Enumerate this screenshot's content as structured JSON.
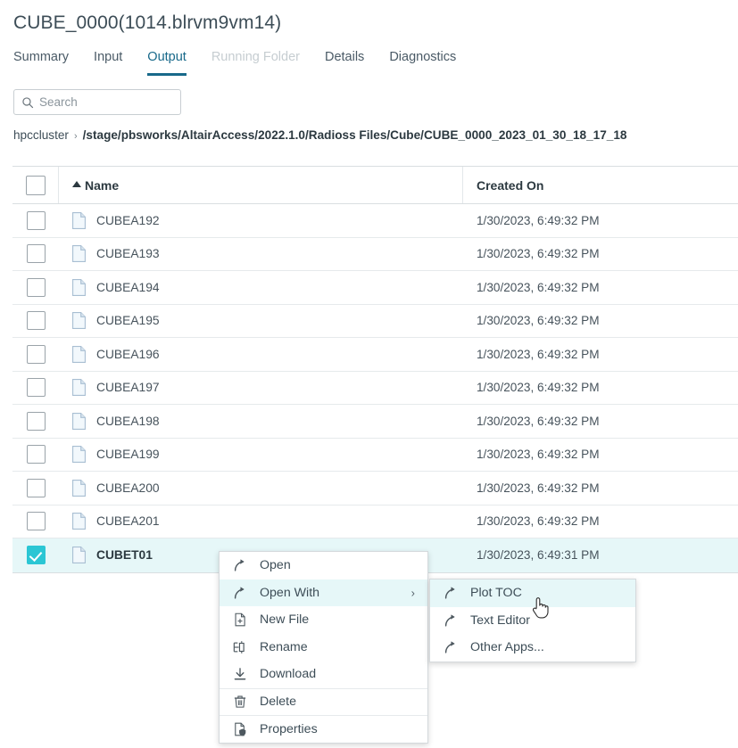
{
  "header": {
    "job_title": "CUBE_0000(1014.blrvm9vm14)"
  },
  "tabs": [
    {
      "label": "Summary",
      "state": "normal"
    },
    {
      "label": "Input",
      "state": "normal"
    },
    {
      "label": "Output",
      "state": "active"
    },
    {
      "label": "Running Folder",
      "state": "disabled"
    },
    {
      "label": "Details",
      "state": "normal"
    },
    {
      "label": "Diagnostics",
      "state": "normal"
    }
  ],
  "search": {
    "placeholder": "Search",
    "value": "",
    "icon": "search-icon"
  },
  "breadcrumb": {
    "root": "hpccluster",
    "separator": "›",
    "path": "/stage/pbsworks/AltairAccess/2022.1.0/Radioss Files/Cube/CUBE_0000_2023_01_30_18_17_18"
  },
  "table": {
    "columns": [
      {
        "key": "name",
        "label": "Name",
        "sorted": "asc"
      },
      {
        "key": "created",
        "label": "Created On",
        "sorted": ""
      }
    ],
    "header_checkbox_checked": false,
    "rows": [
      {
        "name": "CUBEA192",
        "created": "1/30/2023, 6:49:32 PM",
        "selected": false
      },
      {
        "name": "CUBEA193",
        "created": "1/30/2023, 6:49:32 PM",
        "selected": false
      },
      {
        "name": "CUBEA194",
        "created": "1/30/2023, 6:49:32 PM",
        "selected": false
      },
      {
        "name": "CUBEA195",
        "created": "1/30/2023, 6:49:32 PM",
        "selected": false
      },
      {
        "name": "CUBEA196",
        "created": "1/30/2023, 6:49:32 PM",
        "selected": false
      },
      {
        "name": "CUBEA197",
        "created": "1/30/2023, 6:49:32 PM",
        "selected": false
      },
      {
        "name": "CUBEA198",
        "created": "1/30/2023, 6:49:32 PM",
        "selected": false
      },
      {
        "name": "CUBEA199",
        "created": "1/30/2023, 6:49:32 PM",
        "selected": false
      },
      {
        "name": "CUBEA200",
        "created": "1/30/2023, 6:49:32 PM",
        "selected": false
      },
      {
        "name": "CUBEA201",
        "created": "1/30/2023, 6:49:32 PM",
        "selected": false
      },
      {
        "name": "CUBET01",
        "created": "1/30/2023, 6:49:31 PM",
        "selected": true
      }
    ]
  },
  "context_menu": {
    "items": [
      {
        "label": "Open",
        "icon": "open-arrow-icon",
        "highlight": false,
        "has_submenu": false,
        "group_start": false
      },
      {
        "label": "Open With",
        "icon": "open-arrow-icon",
        "highlight": true,
        "has_submenu": true,
        "group_start": false,
        "submenu_arrow": "›"
      },
      {
        "label": "New File",
        "icon": "new-file-icon",
        "highlight": false,
        "has_submenu": false,
        "group_start": false
      },
      {
        "label": "Rename",
        "icon": "rename-icon",
        "highlight": false,
        "has_submenu": false,
        "group_start": false
      },
      {
        "label": "Download",
        "icon": "download-icon",
        "highlight": false,
        "has_submenu": false,
        "group_start": false
      },
      {
        "label": "Delete",
        "icon": "trash-icon",
        "highlight": false,
        "has_submenu": false,
        "group_start": true
      },
      {
        "label": "Properties",
        "icon": "properties-icon",
        "highlight": false,
        "has_submenu": false,
        "group_start": true
      }
    ]
  },
  "context_submenu": {
    "items": [
      {
        "label": "Plot TOC",
        "icon": "open-arrow-icon",
        "highlight": true
      },
      {
        "label": "Text Editor",
        "icon": "open-arrow-icon",
        "highlight": false
      },
      {
        "label": "Other Apps...",
        "icon": "open-arrow-icon",
        "highlight": false
      }
    ]
  },
  "cursor": {
    "type": "pointing-hand-cursor"
  },
  "colors": {
    "accent_teal": "#2bc6d4",
    "tab_active": "#18698a",
    "row_selected_bg": "#e6f7f8",
    "text_primary": "#3d4d57",
    "border": "#d9dee1"
  }
}
